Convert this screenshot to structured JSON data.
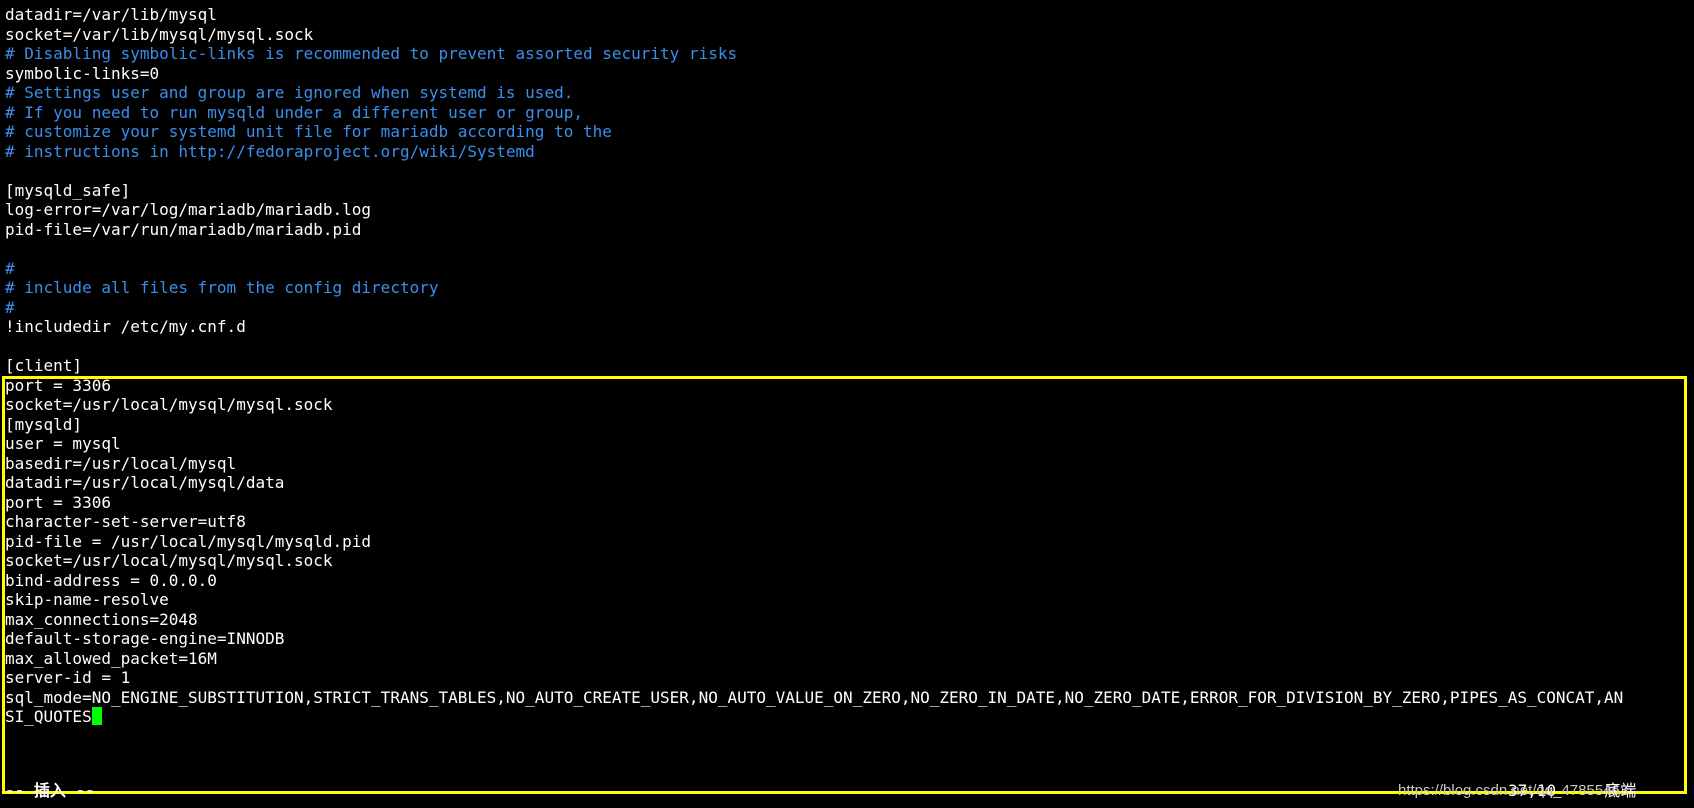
{
  "editor": {
    "lines": [
      {
        "text": "datadir=/var/lib/mysql",
        "type": "normal"
      },
      {
        "text": "socket=/var/lib/mysql/mysql.sock",
        "type": "normal"
      },
      {
        "text": "# Disabling symbolic-links is recommended to prevent assorted security risks",
        "type": "comment"
      },
      {
        "text": "symbolic-links=0",
        "type": "normal"
      },
      {
        "text": "# Settings user and group are ignored when systemd is used.",
        "type": "comment"
      },
      {
        "text": "# If you need to run mysqld under a different user or group,",
        "type": "comment"
      },
      {
        "text": "# customize your systemd unit file for mariadb according to the",
        "type": "comment"
      },
      {
        "text": "# instructions in http://fedoraproject.org/wiki/Systemd",
        "type": "comment"
      },
      {
        "text": "",
        "type": "normal"
      },
      {
        "text": "[mysqld_safe]",
        "type": "normal"
      },
      {
        "text": "log-error=/var/log/mariadb/mariadb.log",
        "type": "normal"
      },
      {
        "text": "pid-file=/var/run/mariadb/mariadb.pid",
        "type": "normal"
      },
      {
        "text": "",
        "type": "normal"
      },
      {
        "text": "#",
        "type": "comment"
      },
      {
        "text": "# include all files from the config directory",
        "type": "comment"
      },
      {
        "text": "#",
        "type": "comment"
      },
      {
        "text": "!includedir /etc/my.cnf.d",
        "type": "normal"
      },
      {
        "text": "",
        "type": "normal"
      },
      {
        "text": "[client]",
        "type": "normal"
      },
      {
        "text": "port = 3306",
        "type": "normal"
      },
      {
        "text": "socket=/usr/local/mysql/mysql.sock",
        "type": "normal"
      },
      {
        "text": "[mysqld]",
        "type": "normal"
      },
      {
        "text": "user = mysql",
        "type": "normal"
      },
      {
        "text": "basedir=/usr/local/mysql",
        "type": "normal"
      },
      {
        "text": "datadir=/usr/local/mysql/data",
        "type": "normal"
      },
      {
        "text": "port = 3306",
        "type": "normal"
      },
      {
        "text": "character-set-server=utf8",
        "type": "normal"
      },
      {
        "text": "pid-file = /usr/local/mysql/mysqld.pid",
        "type": "normal"
      },
      {
        "text": "socket=/usr/local/mysql/mysql.sock",
        "type": "normal"
      },
      {
        "text": "bind-address = 0.0.0.0",
        "type": "normal"
      },
      {
        "text": "skip-name-resolve",
        "type": "normal"
      },
      {
        "text": "max_connections=2048",
        "type": "normal"
      },
      {
        "text": "default-storage-engine=INNODB",
        "type": "normal"
      },
      {
        "text": "max_allowed_packet=16M",
        "type": "normal"
      },
      {
        "text": "server-id = 1",
        "type": "normal"
      },
      {
        "text": "sql_mode=NO_ENGINE_SUBSTITUTION,STRICT_TRANS_TABLES,NO_AUTO_CREATE_USER,NO_AUTO_VALUE_ON_ZERO,NO_ZERO_IN_DATE,NO_ZERO_DATE,ERROR_FOR_DIVISION_BY_ZERO,PIPES_AS_CONCAT,AN",
        "type": "normal"
      },
      {
        "text": "SI_QUOTES",
        "type": "normal",
        "cursor": true
      }
    ],
    "status_mode": "-- 插入 --",
    "ruler": "37,10     底端",
    "watermark": "https://blog.csdn.net/qq_47855463"
  },
  "colors": {
    "background": "#000000",
    "text": "#ffffff",
    "comment": "#3b8eea",
    "highlight_border": "#ffff00",
    "cursor": "#00ff00"
  }
}
